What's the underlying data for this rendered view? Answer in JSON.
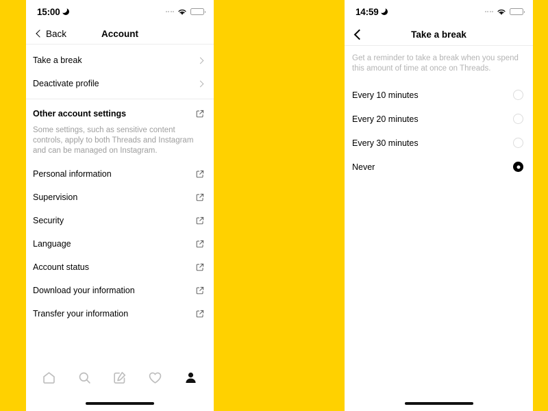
{
  "theme": {
    "background": "#FFD100",
    "panel": "#FFFFFF",
    "text": "#000000",
    "muted": "#9E9E9E",
    "divider": "#ECECEC",
    "battery_low": "#E8192C"
  },
  "left_phone": {
    "status_bar": {
      "time": "15:00",
      "moon_icon": "crescent-moon-icon",
      "signal_icon": "signal-dots-icon",
      "wifi_icon": "wifi-icon",
      "battery_icon": "battery-low-icon"
    },
    "header": {
      "back_label": "Back",
      "back_icon": "chevron-left-icon",
      "title": "Account"
    },
    "top_items": [
      {
        "label": "Take a break",
        "accessory": "chevron-right-icon"
      },
      {
        "label": "Deactivate profile",
        "accessory": "chevron-right-icon"
      }
    ],
    "section": {
      "title": "Other account settings",
      "accessory": "external-link-icon",
      "description": "Some settings, such as sensitive content controls, apply to both Threads and Instagram and can be managed on Instagram."
    },
    "external_items": [
      {
        "label": "Personal information",
        "accessory": "external-link-icon"
      },
      {
        "label": "Supervision",
        "accessory": "external-link-icon"
      },
      {
        "label": "Security",
        "accessory": "external-link-icon"
      },
      {
        "label": "Language",
        "accessory": "external-link-icon"
      },
      {
        "label": "Account status",
        "accessory": "external-link-icon"
      },
      {
        "label": "Download your information",
        "accessory": "external-link-icon"
      },
      {
        "label": "Transfer your information",
        "accessory": "external-link-icon"
      }
    ],
    "tabbar": [
      {
        "name": "home-icon",
        "active": false
      },
      {
        "name": "search-icon",
        "active": false
      },
      {
        "name": "compose-icon",
        "active": false
      },
      {
        "name": "heart-icon",
        "active": false
      },
      {
        "name": "profile-icon",
        "active": true
      }
    ]
  },
  "right_phone": {
    "status_bar": {
      "time": "14:59",
      "moon_icon": "crescent-moon-icon",
      "signal_icon": "signal-dots-icon",
      "wifi_icon": "wifi-icon",
      "battery_icon": "battery-low-icon"
    },
    "header": {
      "back_icon": "chevron-left-icon",
      "title": "Take a break"
    },
    "description": "Get a reminder to take a break when you spend this amount of time at once on Threads.",
    "options": [
      {
        "label": "Every 10 minutes",
        "selected": false
      },
      {
        "label": "Every 20 minutes",
        "selected": false
      },
      {
        "label": "Every 30 minutes",
        "selected": false
      },
      {
        "label": "Never",
        "selected": true
      }
    ]
  }
}
